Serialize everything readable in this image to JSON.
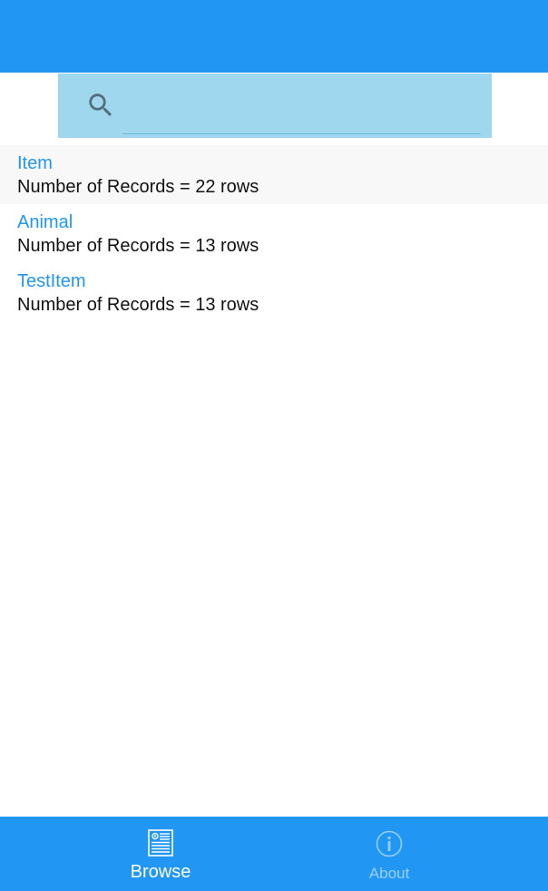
{
  "search": {
    "placeholder": "",
    "value": ""
  },
  "records": [
    {
      "title": "Item",
      "detail": "Number of Records = 22 rows"
    },
    {
      "title": "Animal",
      "detail": "Number of Records = 13 rows"
    },
    {
      "title": "TestItem",
      "detail": "Number of Records = 13 rows"
    }
  ],
  "bottom_nav": {
    "tabs": [
      {
        "label": "Browse",
        "icon": "browse-icon",
        "selected": true
      },
      {
        "label": "About",
        "icon": "info-icon",
        "selected": false
      }
    ]
  },
  "colors": {
    "primary": "#2196F3",
    "search_background": "#9FD8EE",
    "title_text": "#2196F3",
    "body_text": "#111111"
  }
}
